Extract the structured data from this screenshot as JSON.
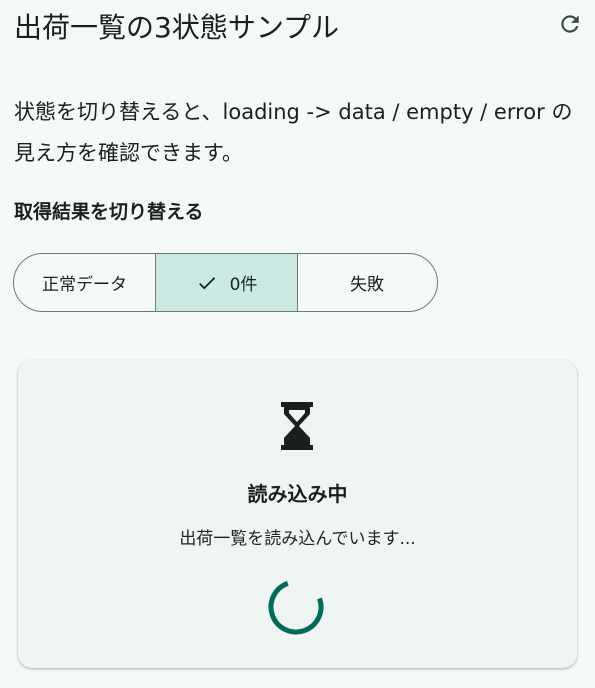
{
  "app_bar": {
    "title": "出荷一覧の3状態サンプル",
    "refresh_icon": "refresh-icon"
  },
  "description": "状態を切り替えると、loading -> data / empty / error の見え方を確認できます。",
  "result_selector": {
    "label": "取得結果を切り替える",
    "options": [
      {
        "label": "正常データ",
        "selected": false
      },
      {
        "label": "0件",
        "selected": true
      },
      {
        "label": "失敗",
        "selected": false
      }
    ]
  },
  "status_card": {
    "icon": "hourglass-icon",
    "title": "読み込み中",
    "message": "出荷一覧を読み込んでいます...",
    "progress_icon": "loading-spinner"
  },
  "colors": {
    "background": "#f4faf8",
    "selected_segment": "#cce8e2",
    "accent": "#006b5c",
    "card": "#eff5f2",
    "outline": "#6e7a77"
  }
}
